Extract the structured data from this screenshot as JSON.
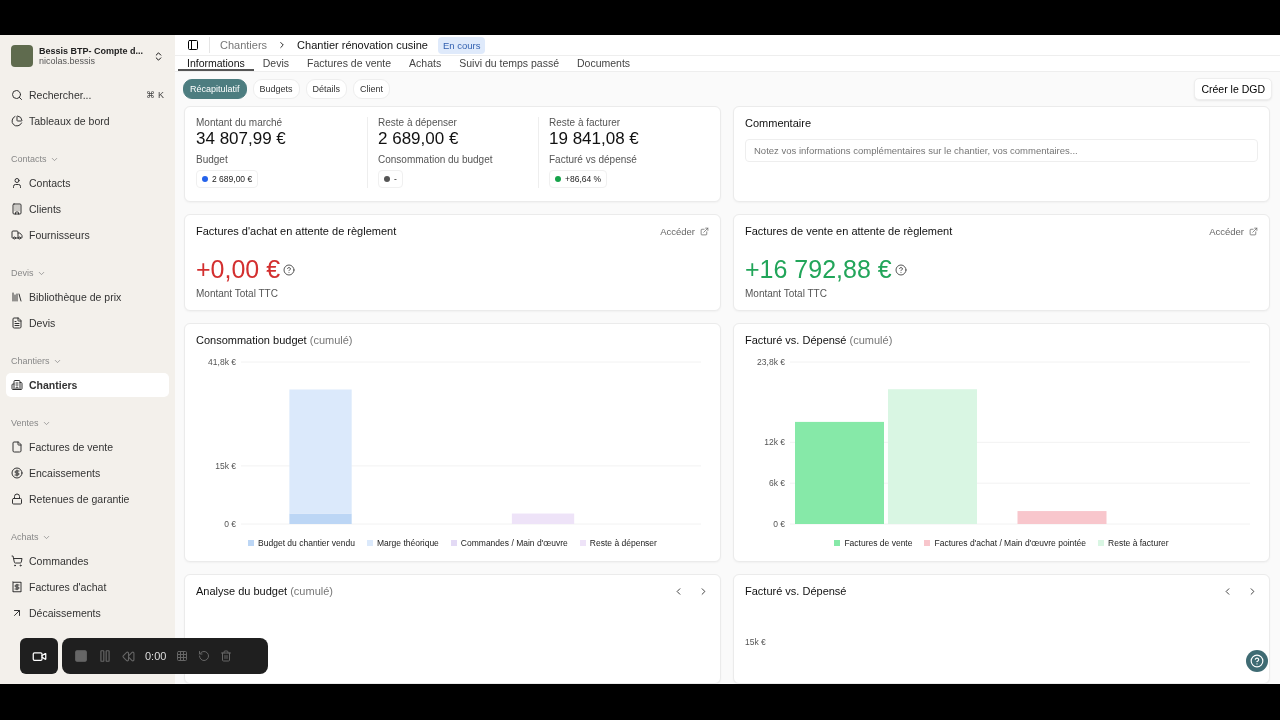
{
  "sidebar": {
    "account": {
      "name": "Bessis BTP- Compte d...",
      "user": "nicolas.bessis"
    },
    "top_items": [
      {
        "label": "Rechercher...",
        "shortcut": "⌘ K",
        "selected": false
      },
      {
        "label": "Tableaux de bord",
        "selected": false
      }
    ],
    "sections": [
      {
        "label": "Contacts",
        "items": [
          {
            "label": "Contacts",
            "selected": false
          },
          {
            "label": "Clients",
            "selected": false
          },
          {
            "label": "Fournisseurs",
            "selected": false
          }
        ]
      },
      {
        "label": "Devis",
        "items": [
          {
            "label": "Bibliothèque de prix",
            "selected": false
          },
          {
            "label": "Devis",
            "selected": false
          }
        ]
      },
      {
        "label": "Chantiers",
        "items": [
          {
            "label": "Chantiers",
            "selected": true
          }
        ]
      },
      {
        "label": "Ventes",
        "items": [
          {
            "label": "Factures de vente",
            "selected": false
          },
          {
            "label": "Encaissements",
            "selected": false
          },
          {
            "label": "Retenues de garantie",
            "selected": false
          }
        ]
      },
      {
        "label": "Achats",
        "items": [
          {
            "label": "Commandes",
            "selected": false
          },
          {
            "label": "Factures d'achat",
            "selected": false
          },
          {
            "label": "Décaissements",
            "selected": false
          }
        ]
      }
    ]
  },
  "breadcrumb": {
    "parent": "Chantiers",
    "current": "Chantier rénovation cusine",
    "status": "En cours"
  },
  "tabs": [
    {
      "label": "Informations",
      "selected": true
    },
    {
      "label": "Devis",
      "selected": false
    },
    {
      "label": "Factures de vente",
      "selected": false
    },
    {
      "label": "Achats",
      "selected": false
    },
    {
      "label": "Suivi du temps passé",
      "selected": false
    },
    {
      "label": "Documents",
      "selected": false
    }
  ],
  "subtabs": [
    {
      "label": "Récapitulatif",
      "selected": true
    },
    {
      "label": "Budgets",
      "selected": false
    },
    {
      "label": "Détails",
      "selected": false
    },
    {
      "label": "Client",
      "selected": false
    }
  ],
  "action_button": "Créer le DGD",
  "stats": [
    {
      "label": "Montant du marché",
      "value": "34 807,99 €",
      "sublabel": "Budget",
      "chip": "2 689,00 €",
      "color": "#2563eb"
    },
    {
      "label": "Reste à dépenser",
      "value": "2 689,00 €",
      "sublabel": "Consommation du budget",
      "chip": "-",
      "color": "#555555"
    },
    {
      "label": "Reste à facturer",
      "value": "19 841,08 €",
      "sublabel": "Facturé vs dépensé",
      "chip": "+86,64 %",
      "color": "#16a34a"
    }
  ],
  "comment": {
    "title": "Commentaire",
    "placeholder": "Notez vos informations complémentaires sur le chantier, vos commentaires..."
  },
  "pending": [
    {
      "title": "Factures d'achat en attente de règlement",
      "link": "Accéder",
      "amount": "+0,00 €",
      "caption": "Montant Total TTC",
      "color": "#d32f2f"
    },
    {
      "title": "Factures de vente en attente de règlement",
      "link": "Accéder",
      "amount": "+16 792,88 €",
      "caption": "Montant Total TTC",
      "color": "#22a55a"
    }
  ],
  "charts": [
    {
      "title": "Consommation budget",
      "note": "(cumulé)",
      "chart_data": {
        "type": "bar",
        "stacked": true,
        "legend": "bottom",
        "ylim": [
          0,
          41800
        ],
        "yticks": [
          {
            "value": 0,
            "label": "0 €"
          },
          {
            "value": 15000,
            "label": "15k €"
          },
          {
            "value": 41800,
            "label": "41,8k €"
          }
        ],
        "series": [
          {
            "name": "Budget du chantier vendu",
            "color": "#bcd6f5",
            "values": [
              2700,
              0
            ]
          },
          {
            "name": "Marge théorique",
            "color": "#dbe9fb",
            "values": [
              32000,
              0
            ]
          },
          {
            "name": "Commandes / Main d'œuvre",
            "color": "#e3daf5",
            "values": [
              0,
              0
            ]
          },
          {
            "name": "Reste à dépenser",
            "color": "#eee3f8",
            "values": [
              0,
              2700
            ]
          }
        ]
      }
    },
    {
      "title": "Facturé vs. Dépensé",
      "note": "(cumulé)",
      "chart_data": {
        "type": "bar",
        "stacked": false,
        "legend": "bottom",
        "ylim": [
          0,
          23800
        ],
        "yticks": [
          {
            "value": 0,
            "label": "0 €"
          },
          {
            "value": 6000,
            "label": "6k €"
          },
          {
            "value": 12000,
            "label": "12k €"
          },
          {
            "value": 23800,
            "label": "23,8k €"
          }
        ],
        "series": [
          {
            "name": "Factures de vente",
            "color": "#86e9a8",
            "values": [
              15000,
              null
            ]
          },
          {
            "name": "Factures d'achat / Main d'œuvre pointée",
            "color": "#f8c6cc",
            "values": [
              null,
              1900
            ]
          },
          {
            "name": "Reste à facturer",
            "color": "#d9f6e3",
            "values": [
              19800,
              null
            ]
          }
        ]
      }
    }
  ],
  "bottom_cards": [
    {
      "title": "Analyse du budget",
      "note": "(cumulé)"
    },
    {
      "title": "Facturé vs. Dépensé",
      "tick": "15k €"
    }
  ],
  "recorder": {
    "time": "0:00"
  }
}
